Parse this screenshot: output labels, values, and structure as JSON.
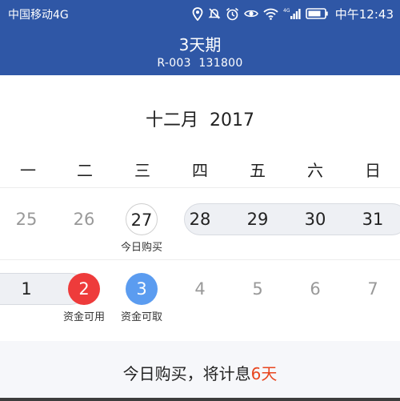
{
  "status_bar": {
    "carrier": "中国移动4G",
    "network": "4G",
    "time": "中午12:43",
    "icons": [
      "location-icon",
      "mute-icon",
      "alarm-icon",
      "eye-icon",
      "wifi-icon",
      "signal-icon",
      "battery-icon"
    ]
  },
  "header": {
    "title": "3天期",
    "code": "R-003",
    "amount": "131800",
    "background": "#2f57a6"
  },
  "calendar": {
    "month_label": "十二月",
    "year": "2017",
    "weekdays": [
      "一",
      "二",
      "三",
      "四",
      "五",
      "六",
      "日"
    ],
    "week1": [
      {
        "day": "25",
        "style": "muted",
        "caption": ""
      },
      {
        "day": "26",
        "style": "muted",
        "caption": ""
      },
      {
        "day": "27",
        "style": "today",
        "caption": "今日购买"
      },
      {
        "day": "28",
        "style": "dark",
        "caption": ""
      },
      {
        "day": "29",
        "style": "dark",
        "caption": ""
      },
      {
        "day": "30",
        "style": "dark",
        "caption": ""
      },
      {
        "day": "31",
        "style": "dark",
        "caption": ""
      }
    ],
    "week2": [
      {
        "day": "1",
        "style": "dark",
        "caption": ""
      },
      {
        "day": "2",
        "style": "red",
        "caption": "资金可用"
      },
      {
        "day": "3",
        "style": "blue",
        "caption": "资金可取"
      },
      {
        "day": "4",
        "style": "muted",
        "caption": ""
      },
      {
        "day": "5",
        "style": "muted",
        "caption": ""
      },
      {
        "day": "6",
        "style": "muted",
        "caption": ""
      },
      {
        "day": "7",
        "style": "muted",
        "caption": ""
      }
    ],
    "colors": {
      "available": "#ee3b3b",
      "withdrawable": "#5b9cf0",
      "range": "#eef0f4"
    }
  },
  "footer": {
    "prefix": "今日购买，将计息",
    "days": "6天",
    "highlight_color": "#e8451e"
  }
}
